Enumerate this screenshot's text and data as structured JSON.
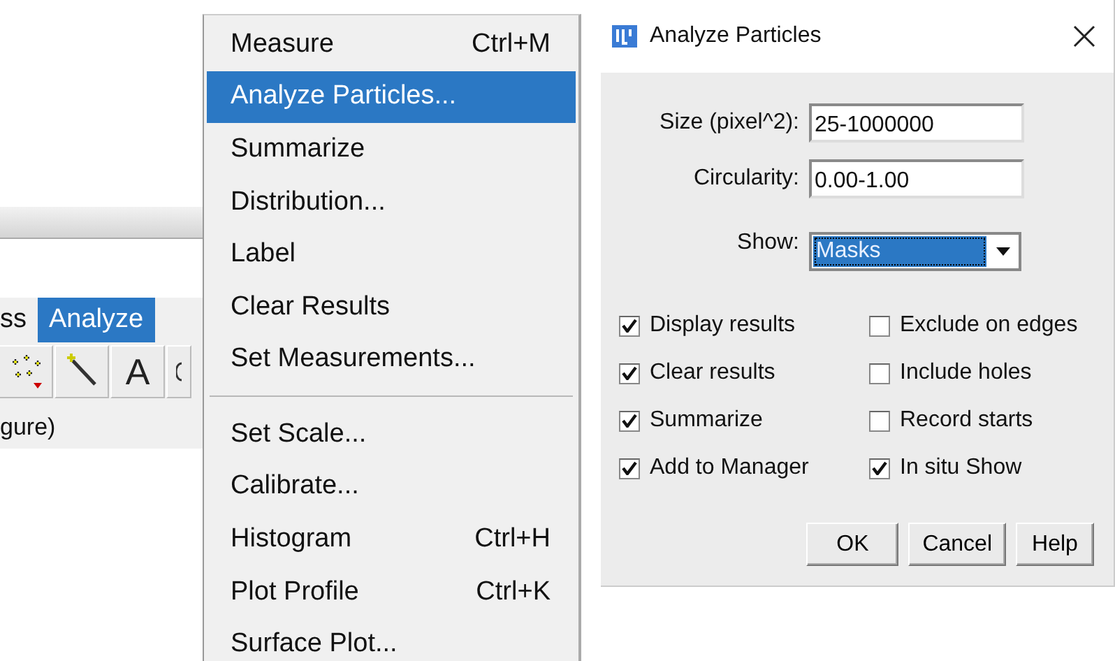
{
  "background_window": {
    "menu_bar": [
      {
        "label": "ss",
        "selected": false
      },
      {
        "label": "Analyze",
        "selected": true
      }
    ],
    "tools": [
      {
        "kind": "multipoint"
      },
      {
        "kind": "wand"
      },
      {
        "kind": "text",
        "label": "A"
      },
      {
        "kind": "partial"
      }
    ],
    "status": "gure)"
  },
  "menu": [
    {
      "kind": "item",
      "label": "Measure",
      "shortcut": "Ctrl+M",
      "selected": false
    },
    {
      "kind": "item",
      "label": "Analyze Particles...",
      "selected": true
    },
    {
      "kind": "item",
      "label": "Summarize",
      "selected": false
    },
    {
      "kind": "item",
      "label": "Distribution...",
      "selected": false
    },
    {
      "kind": "item",
      "label": "Label",
      "selected": false
    },
    {
      "kind": "item",
      "label": "Clear Results",
      "selected": false
    },
    {
      "kind": "item",
      "label": "Set Measurements...",
      "selected": false
    },
    {
      "kind": "separator"
    },
    {
      "kind": "item",
      "label": "Set Scale...",
      "selected": false
    },
    {
      "kind": "item",
      "label": "Calibrate...",
      "selected": false
    },
    {
      "kind": "item",
      "label": "Histogram",
      "shortcut": "Ctrl+H",
      "selected": false
    },
    {
      "kind": "item",
      "label": "Plot Profile",
      "shortcut": "Ctrl+K",
      "selected": false
    },
    {
      "kind": "item",
      "label": "Surface Plot...",
      "selected": false
    }
  ],
  "dialog": {
    "title": "Analyze Particles",
    "fields": [
      {
        "kind": "text",
        "label": "Size (pixel^2):",
        "value": "25-1000000"
      },
      {
        "kind": "text",
        "label": "Circularity:",
        "value": "0.00-1.00"
      },
      {
        "kind": "choice",
        "label": "Show:",
        "value": "Masks"
      }
    ],
    "checkboxes": [
      {
        "label": "Display results",
        "checked": true
      },
      {
        "label": "Exclude on edges",
        "checked": false
      },
      {
        "label": "Clear results",
        "checked": true
      },
      {
        "label": "Include holes",
        "checked": false
      },
      {
        "label": "Summarize",
        "checked": true
      },
      {
        "label": "Record starts",
        "checked": false
      },
      {
        "label": "Add to Manager",
        "checked": true
      },
      {
        "label": "In situ Show",
        "checked": true
      }
    ],
    "buttons": [
      "OK",
      "Cancel",
      "Help"
    ]
  }
}
